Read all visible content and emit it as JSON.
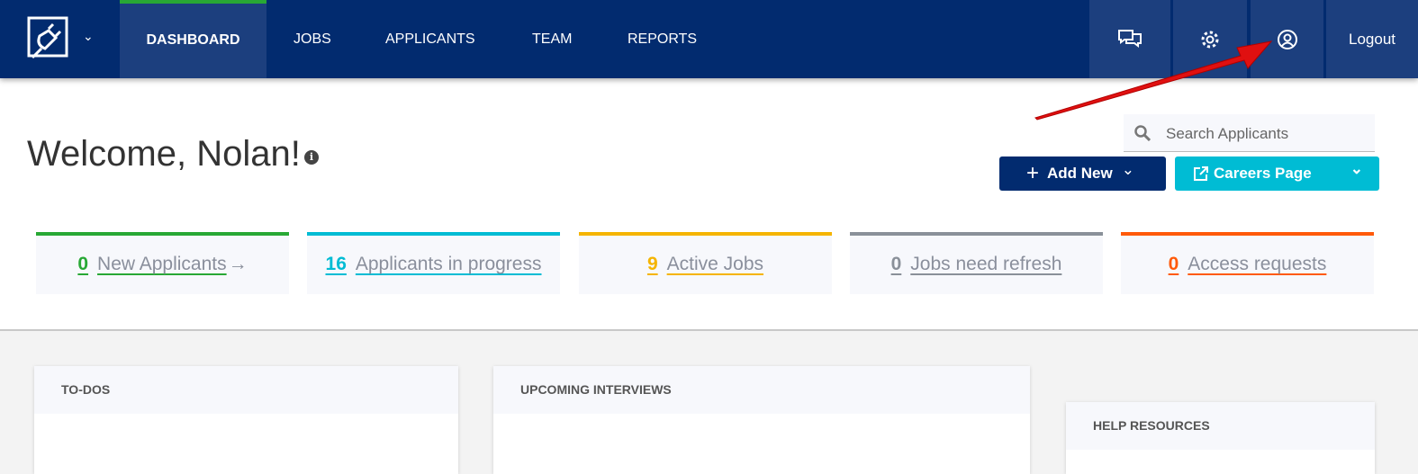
{
  "nav": {
    "tabs": [
      {
        "label": "Dashboard",
        "active": true
      },
      {
        "label": "Jobs"
      },
      {
        "label": "Applicants"
      },
      {
        "label": "Team"
      },
      {
        "label": "Reports"
      }
    ],
    "icons": [
      "chat-icon",
      "gear-icon",
      "user-profile-icon"
    ],
    "logout": "Logout"
  },
  "header": {
    "welcome": "Welcome, Nolan!",
    "info_icon": "i",
    "search_placeholder": "Search Applicants",
    "add_new": "Add New",
    "careers_page": "Careers Page"
  },
  "stats": [
    {
      "value": "0",
      "label": "New Applicants",
      "arrow": "→",
      "color": "#28a835"
    },
    {
      "value": "16",
      "label": "Applicants in progress",
      "color": "#00bcd4"
    },
    {
      "value": "9",
      "label": "Active Jobs",
      "color": "#f5b400"
    },
    {
      "value": "0",
      "label": "Jobs need refresh",
      "color": "#8a9099"
    },
    {
      "value": "0",
      "label": "Access requests",
      "color": "#ff5a0a"
    }
  ],
  "cards": {
    "todos": "TO-DOS",
    "interviews": "UPCOMING INTERVIEWS",
    "help": "HELP RESOURCES"
  },
  "colors": {
    "nav": "#022b6f",
    "nav_active": "#1c3f7e",
    "add_new": "#022b6f",
    "careers": "#00bcd4",
    "annotation_arrow": "#e01010"
  }
}
